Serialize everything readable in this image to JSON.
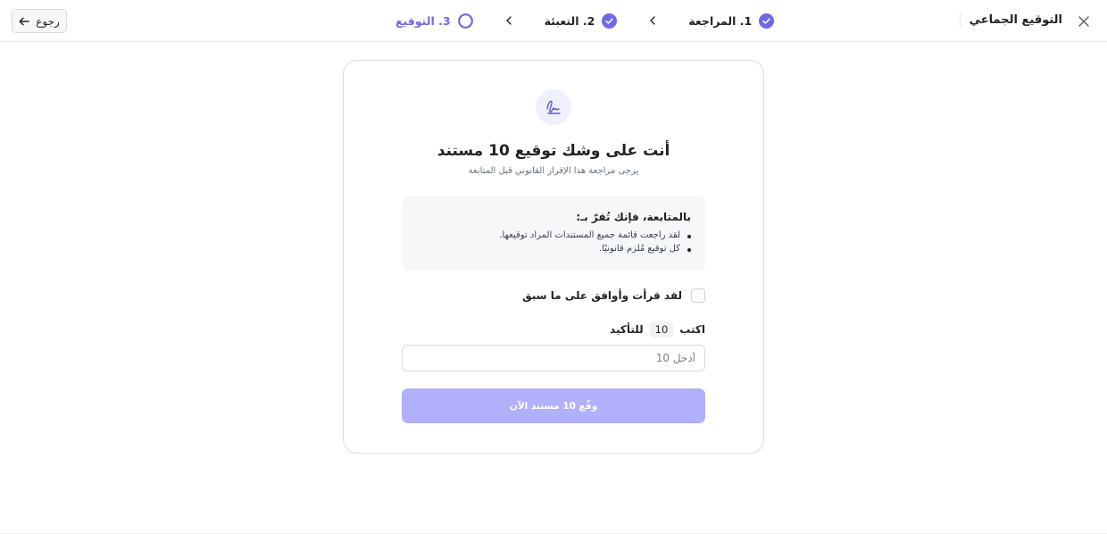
{
  "header": {
    "app_title": "التوقيع الجماعي",
    "back_label": "رجوع",
    "steps": [
      {
        "label": "1. المراجعة",
        "state": "complete"
      },
      {
        "label": "2. التعبئة",
        "state": "complete"
      },
      {
        "label": "3. التوقيع",
        "state": "active"
      }
    ]
  },
  "card": {
    "title": "أنت على وشك توقيع 10 مستند",
    "subtitle": "يرجى مراجعة هذا الإقرار القانوني قبل المتابعة",
    "notice": {
      "heading": "بالمتابعة، فإنك تُقرّ بـ:",
      "items": [
        "لقد راجعت قائمة جميع المستندات المراد توقيعها.",
        "كل توقيع مُلزم قانونيًا."
      ]
    },
    "agree_label": "لقد قرأت وأوافق على ما سبق",
    "confirm": {
      "prefix": "اكتب",
      "code": "10",
      "suffix": "للتأكيد",
      "placeholder": "أدخل 10"
    },
    "sign_button": "وقّع 10 مستند الآن"
  },
  "colors": {
    "accent": "#6d6ae8",
    "button_disabled": "#b0b0fb",
    "card_border": "#dcdde3",
    "notice_bg": "#f6f7f9"
  },
  "icons": {
    "close": "close-icon",
    "back": "arrow-left-icon",
    "step_complete": "check-circle-icon",
    "step_active": "ring-icon",
    "separator": "chevron-left-icon",
    "signature": "signature-icon"
  }
}
